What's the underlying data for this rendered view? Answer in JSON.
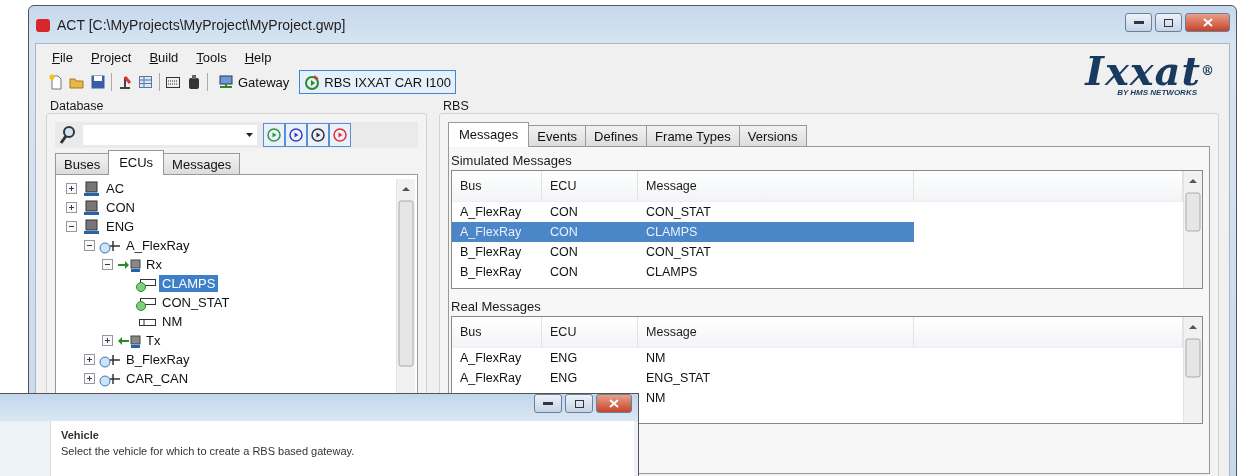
{
  "window": {
    "title": "ACT [C:\\MyProjects\\MyProject\\MyProject.gwp]"
  },
  "menu": [
    "File",
    "Project",
    "Build",
    "Tools",
    "Help"
  ],
  "toolbar": {
    "buttons": [
      {
        "label": "Gateway",
        "selected": false
      },
      {
        "label": "RBS IXXAT CAR I100",
        "selected": true
      }
    ]
  },
  "logo": {
    "name": "Ixxat",
    "mark": "®",
    "tagline": "BY HMS NETWORKS"
  },
  "database": {
    "title": "Database",
    "run_buttons": [
      {
        "color": "#2e9a3a"
      },
      {
        "color": "#3a44b8"
      },
      {
        "color": "#333333"
      },
      {
        "color": "#e03030"
      }
    ],
    "tabs": [
      {
        "label": "Buses",
        "selected": false
      },
      {
        "label": "ECUs",
        "selected": true
      },
      {
        "label": "Messages",
        "selected": false
      }
    ],
    "tree": [
      {
        "label": "AC",
        "kind": "ecu",
        "expanded": false
      },
      {
        "label": "CON",
        "kind": "ecu",
        "expanded": false
      },
      {
        "label": "ENG",
        "kind": "ecu",
        "expanded": true,
        "children": [
          {
            "label": "A_FlexRay",
            "kind": "bus",
            "expanded": true,
            "children": [
              {
                "label": "Rx",
                "kind": "rx",
                "expanded": true,
                "children": [
                  {
                    "label": "CLAMPS",
                    "kind": "message",
                    "selected": true
                  },
                  {
                    "label": "CON_STAT",
                    "kind": "message",
                    "selected": false
                  },
                  {
                    "label": "NM",
                    "kind": "frame",
                    "selected": false
                  }
                ]
              },
              {
                "label": "Tx",
                "kind": "tx",
                "expanded": false
              }
            ]
          },
          {
            "label": "B_FlexRay",
            "kind": "bus",
            "expanded": false
          },
          {
            "label": "CAR_CAN",
            "kind": "bus",
            "expanded": false
          }
        ]
      }
    ]
  },
  "rbs": {
    "title": "RBS",
    "tabs": [
      {
        "label": "Messages",
        "selected": true
      },
      {
        "label": "Events",
        "selected": false
      },
      {
        "label": "Defines",
        "selected": false
      },
      {
        "label": "Frame Types",
        "selected": false
      },
      {
        "label": "Versions",
        "selected": false
      }
    ],
    "simulated": {
      "title": "Simulated Messages",
      "columns": [
        "Bus",
        "ECU",
        "Message"
      ],
      "rows": [
        {
          "bus": "A_FlexRay",
          "ecu": "CON",
          "message": "CON_STAT",
          "selected": false
        },
        {
          "bus": "A_FlexRay",
          "ecu": "CON",
          "message": "CLAMPS",
          "selected": true
        },
        {
          "bus": "B_FlexRay",
          "ecu": "CON",
          "message": "CON_STAT",
          "selected": false
        },
        {
          "bus": "B_FlexRay",
          "ecu": "CON",
          "message": "CLAMPS",
          "selected": false
        }
      ]
    },
    "real": {
      "title": "Real Messages",
      "columns": [
        "Bus",
        "ECU",
        "Message"
      ],
      "rows": [
        {
          "bus": "A_FlexRay",
          "ecu": "ENG",
          "message": "NM",
          "selected": false
        },
        {
          "bus": "A_FlexRay",
          "ecu": "ENG",
          "message": "ENG_STAT",
          "selected": false
        },
        {
          "message": "NM",
          "selected": false
        }
      ]
    }
  },
  "dialog": {
    "heading": "Vehicle",
    "description": "Select the vehicle for which to create a RBS based gateway."
  }
}
